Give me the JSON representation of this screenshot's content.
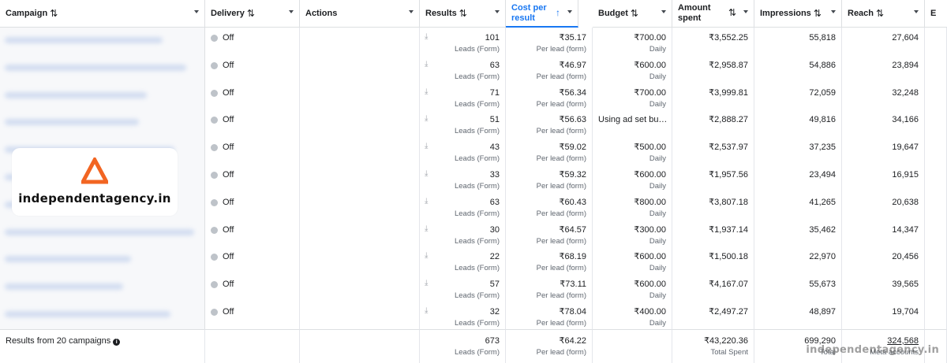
{
  "headers": {
    "campaign": "Campaign",
    "delivery": "Delivery",
    "actions": "Actions",
    "results": "Results",
    "cost_per_result": "Cost per result",
    "budget": "Budget",
    "amount_spent": "Amount spent",
    "impressions": "Impressions",
    "reach": "Reach",
    "extra": "E"
  },
  "rows": [
    {
      "delivery": "Off",
      "results": "101",
      "results_sub": "Leads (Form)",
      "cpr": "₹35.17",
      "cpr_sub": "Per lead (form)",
      "budget": "₹700.00",
      "budget_sub": "Daily",
      "spent": "₹3,552.25",
      "impressions": "55,818",
      "reach": "27,604"
    },
    {
      "delivery": "Off",
      "results": "63",
      "results_sub": "Leads (Form)",
      "cpr": "₹46.97",
      "cpr_sub": "Per lead (form)",
      "budget": "₹600.00",
      "budget_sub": "Daily",
      "spent": "₹2,958.87",
      "impressions": "54,886",
      "reach": "23,894"
    },
    {
      "delivery": "Off",
      "results": "71",
      "results_sub": "Leads (Form)",
      "cpr": "₹56.34",
      "cpr_sub": "Per lead (form)",
      "budget": "₹700.00",
      "budget_sub": "Daily",
      "spent": "₹3,999.81",
      "impressions": "72,059",
      "reach": "32,248"
    },
    {
      "delivery": "Off",
      "results": "51",
      "results_sub": "Leads (Form)",
      "cpr": "₹56.63",
      "cpr_sub": "Per lead (form)",
      "budget": "Using ad set bu…",
      "budget_sub": "",
      "spent": "₹2,888.27",
      "impressions": "49,816",
      "reach": "34,166"
    },
    {
      "delivery": "Off",
      "results": "43",
      "results_sub": "Leads (Form)",
      "cpr": "₹59.02",
      "cpr_sub": "Per lead (form)",
      "budget": "₹500.00",
      "budget_sub": "Daily",
      "spent": "₹2,537.97",
      "impressions": "37,235",
      "reach": "19,647"
    },
    {
      "delivery": "Off",
      "results": "33",
      "results_sub": "Leads (Form)",
      "cpr": "₹59.32",
      "cpr_sub": "Per lead (form)",
      "budget": "₹600.00",
      "budget_sub": "Daily",
      "spent": "₹1,957.56",
      "impressions": "23,494",
      "reach": "16,915"
    },
    {
      "delivery": "Off",
      "results": "63",
      "results_sub": "Leads (Form)",
      "cpr": "₹60.43",
      "cpr_sub": "Per lead (form)",
      "budget": "₹800.00",
      "budget_sub": "Daily",
      "spent": "₹3,807.18",
      "impressions": "41,265",
      "reach": "20,638"
    },
    {
      "delivery": "Off",
      "results": "30",
      "results_sub": "Leads (Form)",
      "cpr": "₹64.57",
      "cpr_sub": "Per lead (form)",
      "budget": "₹300.00",
      "budget_sub": "Daily",
      "spent": "₹1,937.14",
      "impressions": "35,462",
      "reach": "14,347"
    },
    {
      "delivery": "Off",
      "results": "22",
      "results_sub": "Leads (Form)",
      "cpr": "₹68.19",
      "cpr_sub": "Per lead (form)",
      "budget": "₹600.00",
      "budget_sub": "Daily",
      "spent": "₹1,500.18",
      "impressions": "22,970",
      "reach": "20,456"
    },
    {
      "delivery": "Off",
      "results": "57",
      "results_sub": "Leads (Form)",
      "cpr": "₹73.11",
      "cpr_sub": "Per lead (form)",
      "budget": "₹600.00",
      "budget_sub": "Daily",
      "spent": "₹4,167.07",
      "impressions": "55,673",
      "reach": "39,565"
    },
    {
      "delivery": "Off",
      "results": "32",
      "results_sub": "Leads (Form)",
      "cpr": "₹78.04",
      "cpr_sub": "Per lead (form)",
      "budget": "₹400.00",
      "budget_sub": "Daily",
      "spent": "₹2,497.27",
      "impressions": "48,897",
      "reach": "19,704"
    }
  ],
  "footer": {
    "label": "Results from 20 campaigns",
    "results": "673",
    "results_sub": "Leads (Form)",
    "cpr": "₹64.22",
    "cpr_sub": "Per lead (form)",
    "spent": "₹43,220.36",
    "spent_sub": "Total Spent",
    "impressions": "699,290",
    "impressions_sub": "Total",
    "reach": "324,568",
    "reach_sub": "Meta accounts"
  },
  "logo": {
    "text": "independentagency.in",
    "color": "#f26522"
  },
  "watermark": "independentagency.in",
  "colors": {
    "accent": "#1877f2",
    "off_dot": "#bec3c9"
  }
}
